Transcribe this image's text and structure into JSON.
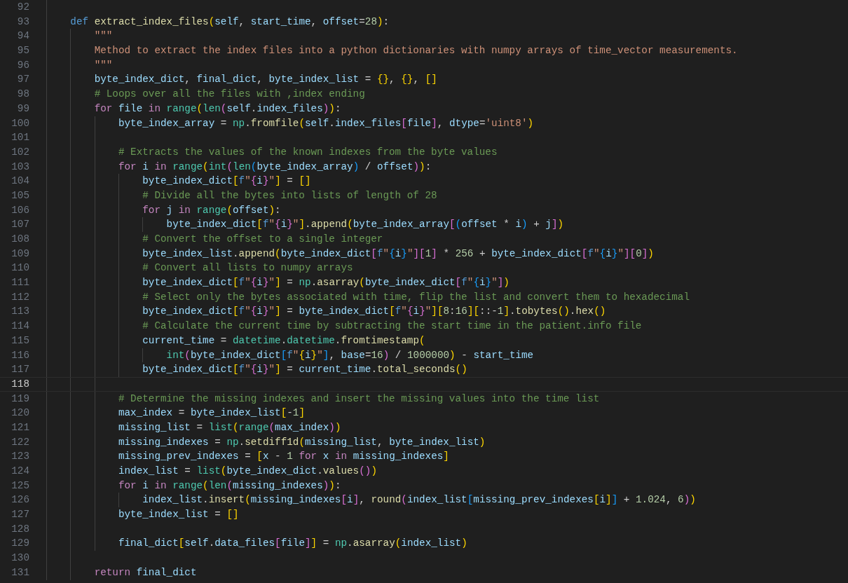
{
  "lines": [
    {
      "number": "92",
      "current": false
    },
    {
      "number": "93",
      "current": false,
      "tokens": [
        {
          "t": "    def",
          "kind": "kw"
        },
        {
          "t": " extract_index_files",
          "kind": "fn"
        },
        {
          "t": "(",
          "kind": "b1"
        },
        {
          "t": "self",
          "kind": "var"
        },
        {
          "t": ", ",
          "kind": "p"
        },
        {
          "t": "start_time",
          "kind": "var"
        },
        {
          "t": ", ",
          "kind": "p"
        },
        {
          "t": "offset",
          "kind": "var"
        },
        {
          "t": "=",
          "kind": "p"
        },
        {
          "t": "28",
          "kind": "num"
        },
        {
          "t": ")",
          "kind": "b1"
        },
        {
          "t": ":",
          "kind": "p"
        }
      ]
    },
    {
      "number": "94",
      "current": false,
      "tokens": [
        {
          "t": "        \"\"\"",
          "kind": "str"
        }
      ]
    },
    {
      "number": "95",
      "current": false,
      "tokens": [
        {
          "t": "        Method to extract the index files into a python dictionaries with numpy arrays of time_vector measurements.",
          "kind": "str"
        }
      ]
    },
    {
      "number": "96",
      "current": false,
      "tokens": [
        {
          "t": "        \"\"\"",
          "kind": "str"
        }
      ]
    },
    {
      "number": "97",
      "current": false,
      "tokens": [
        {
          "t": "        byte_index_dict",
          "kind": "var"
        },
        {
          "t": ", ",
          "kind": "p"
        },
        {
          "t": "final_dict",
          "kind": "var"
        },
        {
          "t": ", ",
          "kind": "p"
        },
        {
          "t": "byte_index_list",
          "kind": "var"
        },
        {
          "t": " = ",
          "kind": "p"
        },
        {
          "t": "{}",
          "kind": "b1"
        },
        {
          "t": ", ",
          "kind": "p"
        },
        {
          "t": "{}",
          "kind": "b1"
        },
        {
          "t": ", ",
          "kind": "p"
        },
        {
          "t": "[]",
          "kind": "b1"
        }
      ]
    },
    {
      "number": "98",
      "current": false,
      "tokens": [
        {
          "t": "        # Loops over all the files with ,index ending",
          "kind": "cmt"
        }
      ]
    },
    {
      "number": "99",
      "current": false,
      "tokens": [
        {
          "t": "        for",
          "kind": "ctrl"
        },
        {
          "t": " file ",
          "kind": "var"
        },
        {
          "t": "in ",
          "kind": "ctrl"
        },
        {
          "t": "range",
          "kind": "cls"
        },
        {
          "t": "(",
          "kind": "b1"
        },
        {
          "t": "len",
          "kind": "cls"
        },
        {
          "t": "(",
          "kind": "b2"
        },
        {
          "t": "self",
          "kind": "var"
        },
        {
          "t": ".",
          "kind": "p"
        },
        {
          "t": "index_files",
          "kind": "var"
        },
        {
          "t": ")",
          "kind": "b2"
        },
        {
          "t": ")",
          "kind": "b1"
        },
        {
          "t": ":",
          "kind": "p"
        }
      ]
    },
    {
      "number": "100",
      "current": false,
      "tokens": [
        {
          "t": "            byte_index_array",
          "kind": "var"
        },
        {
          "t": " = ",
          "kind": "p"
        },
        {
          "t": "np",
          "kind": "cls"
        },
        {
          "t": ".",
          "kind": "p"
        },
        {
          "t": "fromfile",
          "kind": "fn"
        },
        {
          "t": "(",
          "kind": "b1"
        },
        {
          "t": "self",
          "kind": "var"
        },
        {
          "t": ".",
          "kind": "p"
        },
        {
          "t": "index_files",
          "kind": "var"
        },
        {
          "t": "[",
          "kind": "b2"
        },
        {
          "t": "file",
          "kind": "var"
        },
        {
          "t": "]",
          "kind": "b2"
        },
        {
          "t": ", ",
          "kind": "p"
        },
        {
          "t": "dtype",
          "kind": "var"
        },
        {
          "t": "=",
          "kind": "p"
        },
        {
          "t": "'uint8'",
          "kind": "str"
        },
        {
          "t": ")",
          "kind": "b1"
        }
      ]
    },
    {
      "number": "101",
      "current": false
    },
    {
      "number": "102",
      "current": false,
      "tokens": [
        {
          "t": "            # Extracts the values of the known indexes from the byte values",
          "kind": "cmt"
        }
      ]
    },
    {
      "number": "103",
      "current": false,
      "tokens": [
        {
          "t": "            for",
          "kind": "ctrl"
        },
        {
          "t": " i ",
          "kind": "var"
        },
        {
          "t": "in ",
          "kind": "ctrl"
        },
        {
          "t": "range",
          "kind": "cls"
        },
        {
          "t": "(",
          "kind": "b1"
        },
        {
          "t": "int",
          "kind": "cls"
        },
        {
          "t": "(",
          "kind": "b2"
        },
        {
          "t": "len",
          "kind": "cls"
        },
        {
          "t": "(",
          "kind": "b3"
        },
        {
          "t": "byte_index_array",
          "kind": "var"
        },
        {
          "t": ")",
          "kind": "b3"
        },
        {
          "t": " / ",
          "kind": "p"
        },
        {
          "t": "offset",
          "kind": "var"
        },
        {
          "t": ")",
          "kind": "b2"
        },
        {
          "t": ")",
          "kind": "b1"
        },
        {
          "t": ":",
          "kind": "p"
        }
      ]
    },
    {
      "number": "104",
      "current": false,
      "tokens": [
        {
          "t": "                byte_index_dict",
          "kind": "var"
        },
        {
          "t": "[",
          "kind": "b1"
        },
        {
          "t": "f",
          "kind": "kw"
        },
        {
          "t": "\"",
          "kind": "str"
        },
        {
          "t": "{",
          "kind": "b2"
        },
        {
          "t": "i",
          "kind": "var"
        },
        {
          "t": "}",
          "kind": "b2"
        },
        {
          "t": "\"",
          "kind": "str"
        },
        {
          "t": "]",
          "kind": "b1"
        },
        {
          "t": " = ",
          "kind": "p"
        },
        {
          "t": "[]",
          "kind": "b1"
        }
      ]
    },
    {
      "number": "105",
      "current": false,
      "tokens": [
        {
          "t": "                # Divide all the bytes into lists of length of 28",
          "kind": "cmt"
        }
      ]
    },
    {
      "number": "106",
      "current": false,
      "tokens": [
        {
          "t": "                for",
          "kind": "ctrl"
        },
        {
          "t": " j ",
          "kind": "var"
        },
        {
          "t": "in ",
          "kind": "ctrl"
        },
        {
          "t": "range",
          "kind": "cls"
        },
        {
          "t": "(",
          "kind": "b1"
        },
        {
          "t": "offset",
          "kind": "var"
        },
        {
          "t": ")",
          "kind": "b1"
        },
        {
          "t": ":",
          "kind": "p"
        }
      ]
    },
    {
      "number": "107",
      "current": false,
      "tokens": [
        {
          "t": "                    byte_index_dict",
          "kind": "var"
        },
        {
          "t": "[",
          "kind": "b1"
        },
        {
          "t": "f",
          "kind": "kw"
        },
        {
          "t": "\"",
          "kind": "str"
        },
        {
          "t": "{",
          "kind": "b2"
        },
        {
          "t": "i",
          "kind": "var"
        },
        {
          "t": "}",
          "kind": "b2"
        },
        {
          "t": "\"",
          "kind": "str"
        },
        {
          "t": "]",
          "kind": "b1"
        },
        {
          "t": ".",
          "kind": "p"
        },
        {
          "t": "append",
          "kind": "fn"
        },
        {
          "t": "(",
          "kind": "b1"
        },
        {
          "t": "byte_index_array",
          "kind": "var"
        },
        {
          "t": "[",
          "kind": "b2"
        },
        {
          "t": "(",
          "kind": "b3"
        },
        {
          "t": "offset",
          "kind": "var"
        },
        {
          "t": " * ",
          "kind": "p"
        },
        {
          "t": "i",
          "kind": "var"
        },
        {
          "t": ")",
          "kind": "b3"
        },
        {
          "t": " + ",
          "kind": "p"
        },
        {
          "t": "j",
          "kind": "var"
        },
        {
          "t": "]",
          "kind": "b2"
        },
        {
          "t": ")",
          "kind": "b1"
        }
      ]
    },
    {
      "number": "108",
      "current": false,
      "tokens": [
        {
          "t": "                # Convert the offset to a single integer",
          "kind": "cmt"
        }
      ]
    },
    {
      "number": "109",
      "current": false,
      "tokens": [
        {
          "t": "                byte_index_list",
          "kind": "var"
        },
        {
          "t": ".",
          "kind": "p"
        },
        {
          "t": "append",
          "kind": "fn"
        },
        {
          "t": "(",
          "kind": "b1"
        },
        {
          "t": "byte_index_dict",
          "kind": "var"
        },
        {
          "t": "[",
          "kind": "b2"
        },
        {
          "t": "f",
          "kind": "kw"
        },
        {
          "t": "\"",
          "kind": "str"
        },
        {
          "t": "{",
          "kind": "b3"
        },
        {
          "t": "i",
          "kind": "var"
        },
        {
          "t": "}",
          "kind": "b3"
        },
        {
          "t": "\"",
          "kind": "str"
        },
        {
          "t": "]",
          "kind": "b2"
        },
        {
          "t": "[",
          "kind": "b2"
        },
        {
          "t": "1",
          "kind": "num"
        },
        {
          "t": "]",
          "kind": "b2"
        },
        {
          "t": " * ",
          "kind": "p"
        },
        {
          "t": "256",
          "kind": "num"
        },
        {
          "t": " + ",
          "kind": "p"
        },
        {
          "t": "byte_index_dict",
          "kind": "var"
        },
        {
          "t": "[",
          "kind": "b2"
        },
        {
          "t": "f",
          "kind": "kw"
        },
        {
          "t": "\"",
          "kind": "str"
        },
        {
          "t": "{",
          "kind": "b3"
        },
        {
          "t": "i",
          "kind": "var"
        },
        {
          "t": "}",
          "kind": "b3"
        },
        {
          "t": "\"",
          "kind": "str"
        },
        {
          "t": "]",
          "kind": "b2"
        },
        {
          "t": "[",
          "kind": "b2"
        },
        {
          "t": "0",
          "kind": "num"
        },
        {
          "t": "]",
          "kind": "b2"
        },
        {
          "t": ")",
          "kind": "b1"
        }
      ]
    },
    {
      "number": "110",
      "current": false,
      "tokens": [
        {
          "t": "                # Convert all lists to numpy arrays",
          "kind": "cmt"
        }
      ]
    },
    {
      "number": "111",
      "current": false,
      "tokens": [
        {
          "t": "                byte_index_dict",
          "kind": "var"
        },
        {
          "t": "[",
          "kind": "b1"
        },
        {
          "t": "f",
          "kind": "kw"
        },
        {
          "t": "\"",
          "kind": "str"
        },
        {
          "t": "{",
          "kind": "b2"
        },
        {
          "t": "i",
          "kind": "var"
        },
        {
          "t": "}",
          "kind": "b2"
        },
        {
          "t": "\"",
          "kind": "str"
        },
        {
          "t": "]",
          "kind": "b1"
        },
        {
          "t": " = ",
          "kind": "p"
        },
        {
          "t": "np",
          "kind": "cls"
        },
        {
          "t": ".",
          "kind": "p"
        },
        {
          "t": "asarray",
          "kind": "fn"
        },
        {
          "t": "(",
          "kind": "b1"
        },
        {
          "t": "byte_index_dict",
          "kind": "var"
        },
        {
          "t": "[",
          "kind": "b2"
        },
        {
          "t": "f",
          "kind": "kw"
        },
        {
          "t": "\"",
          "kind": "str"
        },
        {
          "t": "{",
          "kind": "b3"
        },
        {
          "t": "i",
          "kind": "var"
        },
        {
          "t": "}",
          "kind": "b3"
        },
        {
          "t": "\"",
          "kind": "str"
        },
        {
          "t": "]",
          "kind": "b2"
        },
        {
          "t": ")",
          "kind": "b1"
        }
      ]
    },
    {
      "number": "112",
      "current": false,
      "tokens": [
        {
          "t": "                # Select only the bytes associated with time, flip the list and convert them to hexadecimal",
          "kind": "cmt"
        }
      ]
    },
    {
      "number": "113",
      "current": false,
      "tokens": [
        {
          "t": "                byte_index_dict",
          "kind": "var"
        },
        {
          "t": "[",
          "kind": "b1"
        },
        {
          "t": "f",
          "kind": "kw"
        },
        {
          "t": "\"",
          "kind": "str"
        },
        {
          "t": "{",
          "kind": "b2"
        },
        {
          "t": "i",
          "kind": "var"
        },
        {
          "t": "}",
          "kind": "b2"
        },
        {
          "t": "\"",
          "kind": "str"
        },
        {
          "t": "]",
          "kind": "b1"
        },
        {
          "t": " = ",
          "kind": "p"
        },
        {
          "t": "byte_index_dict",
          "kind": "var"
        },
        {
          "t": "[",
          "kind": "b1"
        },
        {
          "t": "f",
          "kind": "kw"
        },
        {
          "t": "\"",
          "kind": "str"
        },
        {
          "t": "{",
          "kind": "b2"
        },
        {
          "t": "i",
          "kind": "var"
        },
        {
          "t": "}",
          "kind": "b2"
        },
        {
          "t": "\"",
          "kind": "str"
        },
        {
          "t": "]",
          "kind": "b1"
        },
        {
          "t": "[",
          "kind": "b1"
        },
        {
          "t": "8",
          "kind": "num"
        },
        {
          "t": ":",
          "kind": "p"
        },
        {
          "t": "16",
          "kind": "num"
        },
        {
          "t": "]",
          "kind": "b1"
        },
        {
          "t": "[",
          "kind": "b1"
        },
        {
          "t": "::-",
          "kind": "p"
        },
        {
          "t": "1",
          "kind": "num"
        },
        {
          "t": "]",
          "kind": "b1"
        },
        {
          "t": ".",
          "kind": "p"
        },
        {
          "t": "tobytes",
          "kind": "fn"
        },
        {
          "t": "()",
          "kind": "b1"
        },
        {
          "t": ".",
          "kind": "p"
        },
        {
          "t": "hex",
          "kind": "fn"
        },
        {
          "t": "()",
          "kind": "b1"
        }
      ]
    },
    {
      "number": "114",
      "current": false,
      "tokens": [
        {
          "t": "                # Calculate the current time by subtracting the start time in the patient.info file",
          "kind": "cmt"
        }
      ]
    },
    {
      "number": "115",
      "current": false,
      "tokens": [
        {
          "t": "                current_time",
          "kind": "var"
        },
        {
          "t": " = ",
          "kind": "p"
        },
        {
          "t": "datetime",
          "kind": "cls"
        },
        {
          "t": ".",
          "kind": "p"
        },
        {
          "t": "datetime",
          "kind": "cls"
        },
        {
          "t": ".",
          "kind": "p"
        },
        {
          "t": "fromtimestamp",
          "kind": "fn"
        },
        {
          "t": "(",
          "kind": "b1"
        }
      ]
    },
    {
      "number": "116",
      "current": false,
      "tokens": [
        {
          "t": "                    int",
          "kind": "cls"
        },
        {
          "t": "(",
          "kind": "b2"
        },
        {
          "t": "byte_index_dict",
          "kind": "var"
        },
        {
          "t": "[",
          "kind": "b3"
        },
        {
          "t": "f",
          "kind": "kw"
        },
        {
          "t": "\"",
          "kind": "str"
        },
        {
          "t": "{",
          "kind": "b1"
        },
        {
          "t": "i",
          "kind": "var"
        },
        {
          "t": "}",
          "kind": "b1"
        },
        {
          "t": "\"",
          "kind": "str"
        },
        {
          "t": "]",
          "kind": "b3"
        },
        {
          "t": ", ",
          "kind": "p"
        },
        {
          "t": "base",
          "kind": "var"
        },
        {
          "t": "=",
          "kind": "p"
        },
        {
          "t": "16",
          "kind": "num"
        },
        {
          "t": ")",
          "kind": "b2"
        },
        {
          "t": " / ",
          "kind": "p"
        },
        {
          "t": "1000000",
          "kind": "num"
        },
        {
          "t": ")",
          "kind": "b1"
        },
        {
          "t": " - ",
          "kind": "p"
        },
        {
          "t": "start_time",
          "kind": "var"
        }
      ]
    },
    {
      "number": "117",
      "current": false,
      "tokens": [
        {
          "t": "                byte_index_dict",
          "kind": "var"
        },
        {
          "t": "[",
          "kind": "b1"
        },
        {
          "t": "f",
          "kind": "kw"
        },
        {
          "t": "\"",
          "kind": "str"
        },
        {
          "t": "{",
          "kind": "b2"
        },
        {
          "t": "i",
          "kind": "var"
        },
        {
          "t": "}",
          "kind": "b2"
        },
        {
          "t": "\"",
          "kind": "str"
        },
        {
          "t": "]",
          "kind": "b1"
        },
        {
          "t": " = ",
          "kind": "p"
        },
        {
          "t": "current_time",
          "kind": "var"
        },
        {
          "t": ".",
          "kind": "p"
        },
        {
          "t": "total_seconds",
          "kind": "fn"
        },
        {
          "t": "()",
          "kind": "b1"
        }
      ]
    },
    {
      "number": "118",
      "current": true
    },
    {
      "number": "119",
      "current": false,
      "tokens": [
        {
          "t": "            # Determine the missing indexes and insert the missing values into the time list",
          "kind": "cmt"
        }
      ]
    },
    {
      "number": "120",
      "current": false,
      "tokens": [
        {
          "t": "            max_index",
          "kind": "var"
        },
        {
          "t": " = ",
          "kind": "p"
        },
        {
          "t": "byte_index_list",
          "kind": "var"
        },
        {
          "t": "[",
          "kind": "b1"
        },
        {
          "t": "-",
          "kind": "p"
        },
        {
          "t": "1",
          "kind": "num"
        },
        {
          "t": "]",
          "kind": "b1"
        }
      ]
    },
    {
      "number": "121",
      "current": false,
      "tokens": [
        {
          "t": "            missing_list",
          "kind": "var"
        },
        {
          "t": " = ",
          "kind": "p"
        },
        {
          "t": "list",
          "kind": "cls"
        },
        {
          "t": "(",
          "kind": "b1"
        },
        {
          "t": "range",
          "kind": "cls"
        },
        {
          "t": "(",
          "kind": "b2"
        },
        {
          "t": "max_index",
          "kind": "var"
        },
        {
          "t": ")",
          "kind": "b2"
        },
        {
          "t": ")",
          "kind": "b1"
        }
      ]
    },
    {
      "number": "122",
      "current": false,
      "tokens": [
        {
          "t": "            missing_indexes",
          "kind": "var"
        },
        {
          "t": " = ",
          "kind": "p"
        },
        {
          "t": "np",
          "kind": "cls"
        },
        {
          "t": ".",
          "kind": "p"
        },
        {
          "t": "setdiff1d",
          "kind": "fn"
        },
        {
          "t": "(",
          "kind": "b1"
        },
        {
          "t": "missing_list",
          "kind": "var"
        },
        {
          "t": ", ",
          "kind": "p"
        },
        {
          "t": "byte_index_list",
          "kind": "var"
        },
        {
          "t": ")",
          "kind": "b1"
        }
      ]
    },
    {
      "number": "123",
      "current": false,
      "tokens": [
        {
          "t": "            missing_prev_indexes",
          "kind": "var"
        },
        {
          "t": " = ",
          "kind": "p"
        },
        {
          "t": "[",
          "kind": "b1"
        },
        {
          "t": "x",
          "kind": "var"
        },
        {
          "t": " - ",
          "kind": "p"
        },
        {
          "t": "1 ",
          "kind": "num"
        },
        {
          "t": "for",
          "kind": "ctrl"
        },
        {
          "t": " x ",
          "kind": "var"
        },
        {
          "t": "in",
          "kind": "ctrl"
        },
        {
          "t": " missing_indexes",
          "kind": "var"
        },
        {
          "t": "]",
          "kind": "b1"
        }
      ]
    },
    {
      "number": "124",
      "current": false,
      "tokens": [
        {
          "t": "            index_list",
          "kind": "var"
        },
        {
          "t": " = ",
          "kind": "p"
        },
        {
          "t": "list",
          "kind": "cls"
        },
        {
          "t": "(",
          "kind": "b1"
        },
        {
          "t": "byte_index_dict",
          "kind": "var"
        },
        {
          "t": ".",
          "kind": "p"
        },
        {
          "t": "values",
          "kind": "fn"
        },
        {
          "t": "()",
          "kind": "b2"
        },
        {
          "t": ")",
          "kind": "b1"
        }
      ]
    },
    {
      "number": "125",
      "current": false,
      "tokens": [
        {
          "t": "            for",
          "kind": "ctrl"
        },
        {
          "t": " i ",
          "kind": "var"
        },
        {
          "t": "in ",
          "kind": "ctrl"
        },
        {
          "t": "range",
          "kind": "cls"
        },
        {
          "t": "(",
          "kind": "b1"
        },
        {
          "t": "len",
          "kind": "cls"
        },
        {
          "t": "(",
          "kind": "b2"
        },
        {
          "t": "missing_indexes",
          "kind": "var"
        },
        {
          "t": ")",
          "kind": "b2"
        },
        {
          "t": ")",
          "kind": "b1"
        },
        {
          "t": ":",
          "kind": "p"
        }
      ]
    },
    {
      "number": "126",
      "current": false,
      "tokens": [
        {
          "t": "                index_list",
          "kind": "var"
        },
        {
          "t": ".",
          "kind": "p"
        },
        {
          "t": "insert",
          "kind": "fn"
        },
        {
          "t": "(",
          "kind": "b1"
        },
        {
          "t": "missing_indexes",
          "kind": "var"
        },
        {
          "t": "[",
          "kind": "b2"
        },
        {
          "t": "i",
          "kind": "var"
        },
        {
          "t": "]",
          "kind": "b2"
        },
        {
          "t": ", ",
          "kind": "p"
        },
        {
          "t": "round",
          "kind": "fn"
        },
        {
          "t": "(",
          "kind": "b2"
        },
        {
          "t": "index_list",
          "kind": "var"
        },
        {
          "t": "[",
          "kind": "b3"
        },
        {
          "t": "missing_prev_indexes",
          "kind": "var"
        },
        {
          "t": "[",
          "kind": "b1"
        },
        {
          "t": "i",
          "kind": "var"
        },
        {
          "t": "]",
          "kind": "b1"
        },
        {
          "t": "]",
          "kind": "b3"
        },
        {
          "t": " + ",
          "kind": "p"
        },
        {
          "t": "1.024",
          "kind": "num"
        },
        {
          "t": ", ",
          "kind": "p"
        },
        {
          "t": "6",
          "kind": "num"
        },
        {
          "t": ")",
          "kind": "b2"
        },
        {
          "t": ")",
          "kind": "b1"
        }
      ]
    },
    {
      "number": "127",
      "current": false,
      "tokens": [
        {
          "t": "            byte_index_list",
          "kind": "var"
        },
        {
          "t": " = ",
          "kind": "p"
        },
        {
          "t": "[]",
          "kind": "b1"
        }
      ]
    },
    {
      "number": "128",
      "current": false
    },
    {
      "number": "129",
      "current": false,
      "tokens": [
        {
          "t": "            final_dict",
          "kind": "var"
        },
        {
          "t": "[",
          "kind": "b1"
        },
        {
          "t": "self",
          "kind": "var"
        },
        {
          "t": ".",
          "kind": "p"
        },
        {
          "t": "data_files",
          "kind": "var"
        },
        {
          "t": "[",
          "kind": "b2"
        },
        {
          "t": "file",
          "kind": "var"
        },
        {
          "t": "]",
          "kind": "b2"
        },
        {
          "t": "]",
          "kind": "b1"
        },
        {
          "t": " = ",
          "kind": "p"
        },
        {
          "t": "np",
          "kind": "cls"
        },
        {
          "t": ".",
          "kind": "p"
        },
        {
          "t": "asarray",
          "kind": "fn"
        },
        {
          "t": "(",
          "kind": "b1"
        },
        {
          "t": "index_list",
          "kind": "var"
        },
        {
          "t": ")",
          "kind": "b1"
        }
      ]
    },
    {
      "number": "130",
      "current": false
    },
    {
      "number": "131",
      "current": false,
      "tokens": [
        {
          "t": "        return",
          "kind": "ctrl"
        },
        {
          "t": " final_dict",
          "kind": "var"
        }
      ]
    }
  ]
}
